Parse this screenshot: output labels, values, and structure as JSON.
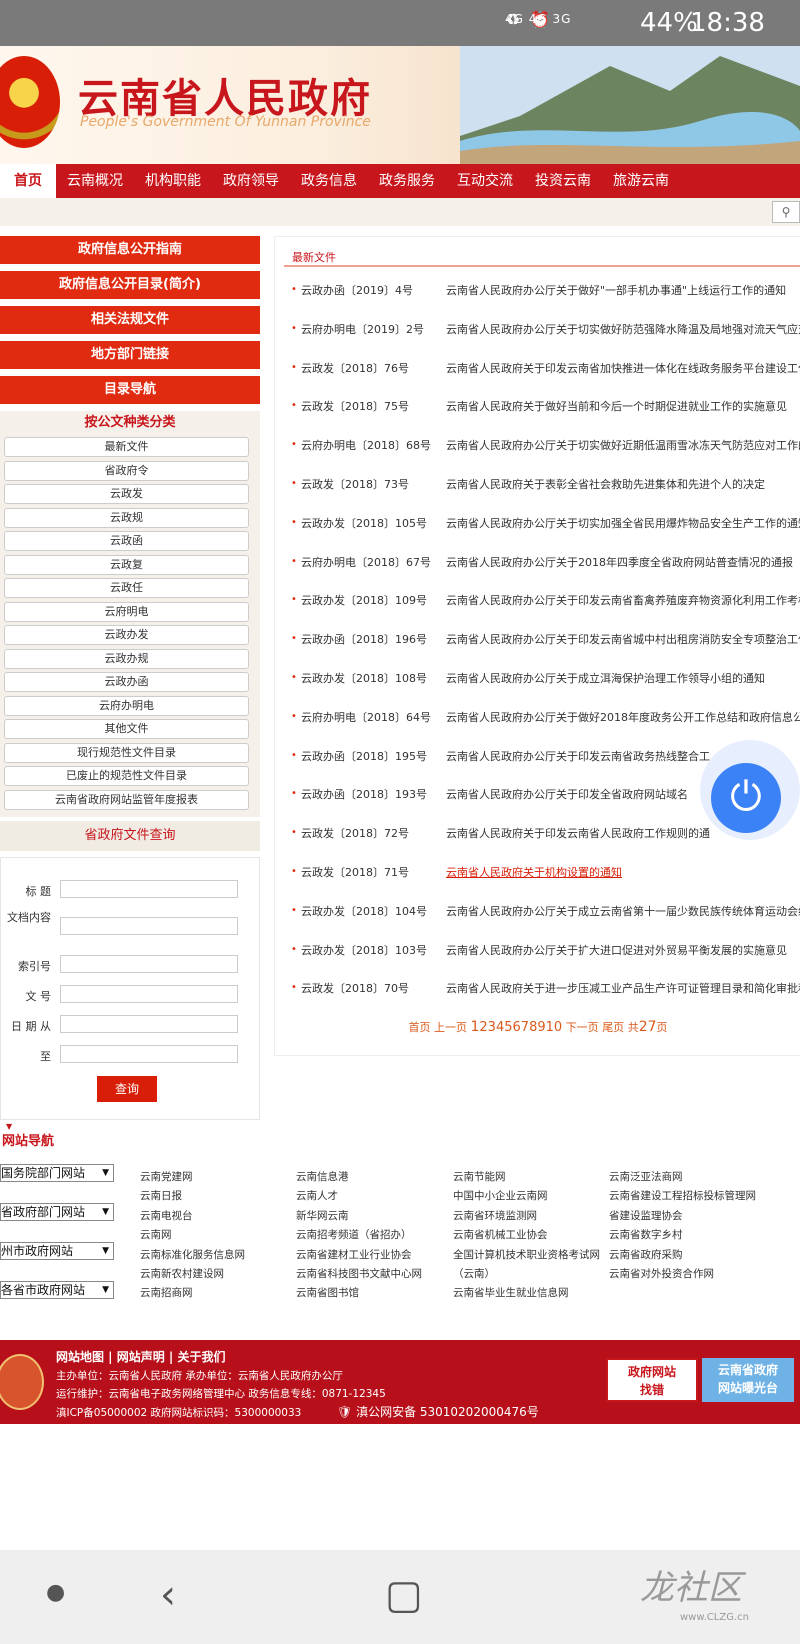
{
  "status_bar": {
    "signal_text": "4G 4G 3G",
    "battery": "44%",
    "time": "18:38"
  },
  "header": {
    "title": "云南省人民政府",
    "subtitle": "People's Government Of Yunnan Province"
  },
  "nav": {
    "items": [
      "首页",
      "云南概况",
      "机构职能",
      "政府领导",
      "政务信息",
      "政务服务",
      "互动交流",
      "投资云南",
      "旅游云南"
    ]
  },
  "sidebar": {
    "red_buttons": [
      "政府信息公开指南",
      "政府信息公开目录(简介)",
      "相关法规文件",
      "地方部门链接",
      "目录导航"
    ],
    "category_title": "按公文种类分类",
    "categories": [
      "最新文件",
      "省政府令",
      "云政发",
      "云政规",
      "云政函",
      "云政复",
      "云政任",
      "云府明电",
      "云政办发",
      "云政办规",
      "云政办函",
      "云府办明电",
      "其他文件",
      "现行规范性文件目录",
      "已废止的规范性文件目录",
      "云南省政府网站监管年度报表"
    ],
    "query_title": "省政府文件查询",
    "query_fields": {
      "title": "标 题",
      "content": "文档内容",
      "index": "索引号",
      "doc_no": "文 号",
      "date_from": "日 期 从",
      "date_to": "至"
    },
    "query_button": "查询"
  },
  "main": {
    "tab_label": "最新文件",
    "rows": [
      {
        "code": "云政办函〔2019〕4号",
        "title": "云南省人民政府办公厅关于做好\"一部手机办事通\"上线运行工作的通知"
      },
      {
        "code": "云府办明电〔2019〕2号",
        "title": "云南省人民政府办公厅关于切实做好防范强降水降温及局地强对流天气应对"
      },
      {
        "code": "云政发〔2018〕76号",
        "title": "云南省人民政府关于印发云南省加快推进一体化在线政务服务平台建设工作"
      },
      {
        "code": "云政发〔2018〕75号",
        "title": "云南省人民政府关于做好当前和今后一个时期促进就业工作的实施意见"
      },
      {
        "code": "云府办明电〔2018〕68号",
        "title": "云南省人民政府办公厅关于切实做好近期低温雨雪冰冻天气防范应对工作的"
      },
      {
        "code": "云政发〔2018〕73号",
        "title": "云南省人民政府关于表彰全省社会救助先进集体和先进个人的决定"
      },
      {
        "code": "云政办发〔2018〕105号",
        "title": "云南省人民政府办公厅关于切实加强全省民用爆炸物品安全生产工作的通知"
      },
      {
        "code": "云府办明电〔2018〕67号",
        "title": "云南省人民政府办公厅关于2018年四季度全省政府网站普查情况的通报"
      },
      {
        "code": "云政办发〔2018〕109号",
        "title": "云南省人民政府办公厅关于印发云南省畜禽养殖废弃物资源化利用工作考核"
      },
      {
        "code": "云政办函〔2018〕196号",
        "title": "云南省人民政府办公厅关于印发云南省城中村出租房消防安全专项整治工作"
      },
      {
        "code": "云政办发〔2018〕108号",
        "title": "云南省人民政府办公厅关于成立洱海保护治理工作领导小组的通知"
      },
      {
        "code": "云府办明电〔2018〕64号",
        "title": "云南省人民政府办公厅关于做好2018年度政务公开工作总结和政府信息公"
      },
      {
        "code": "云政办函〔2018〕195号",
        "title": "云南省人民政府办公厅关于印发云南省政务热线整合工"
      },
      {
        "code": "云政办函〔2018〕193号",
        "title": "云南省人民政府办公厅关于印发全省政府网站域名"
      },
      {
        "code": "云政发〔2018〕72号",
        "title": "云南省人民政府关于印发云南省人民政府工作规则的通"
      },
      {
        "code": "云政发〔2018〕71号",
        "title": "云南省人民政府关于机构设置的通知",
        "link": true
      },
      {
        "code": "云政办发〔2018〕104号",
        "title": "云南省人民政府办公厅关于成立云南省第十一届少数民族传统体育运动会组"
      },
      {
        "code": "云政办发〔2018〕103号",
        "title": "云南省人民政府办公厅关于扩大进口促进对外贸易平衡发展的实施意见"
      },
      {
        "code": "云政发〔2018〕70号",
        "title": "云南省人民政府关于进一步压减工业产品生产许可证管理目录和简化审批程"
      }
    ],
    "pager": {
      "first": "首页",
      "prev": "上一页",
      "pages": [
        "1",
        "2",
        "3",
        "4",
        "5",
        "6",
        "7",
        "8",
        "9",
        "10"
      ],
      "next": "下一页",
      "last": "尾页",
      "total_prefix": "共",
      "total": "27",
      "total_suffix": "页"
    }
  },
  "site_nav": {
    "title": "网站导航",
    "selects": [
      "国务院部门网站",
      "省政府部门网站",
      "州市政府网站",
      "各省市政府网站"
    ],
    "col1": [
      "云南党建网",
      "云南日报",
      "云南电视台",
      "云南网",
      "云南标准化服务信息网",
      "云南新农村建设网",
      "云南招商网"
    ],
    "col2": [
      "云南信息港",
      "云南人才",
      "新华网云南",
      "云南招考频道（省招办）",
      "云南省建材工业行业协会",
      "云南省科技图书文献中心网",
      "云南省图书馆"
    ],
    "col3": [
      "云南节能网",
      "中国中小企业云南网",
      "云南省环境监测网",
      "云南省机械工业协会",
      "全国计算机技术职业资格考试网",
      "（云南）",
      "云南省毕业生就业信息网"
    ],
    "col4": [
      "云南泛亚法商网",
      "云南省建设工程招标投标管理网",
      "省建设监理协会",
      "云南省数字乡村",
      "云南省政府采购",
      "云南省对外投资合作网"
    ]
  },
  "footer": {
    "links": "网站地图 | 网站声明 | 关于我们",
    "sponsor": "主办单位：云南省人民政府   承办单位：云南省人民政府办公厅",
    "maintainer": "运行维护：云南省电子政务网络管理中心   政务信息专线：0871-12345",
    "icp": "滇ICP备05000002   政府网站标识码：5300000033",
    "police": "滇公网安备 53010202000476号",
    "btn1": "政府网站\n找错",
    "btn2": "云南省政府\n网站曝光台"
  },
  "watermark": {
    "text": "龙社区",
    "url": "www.CLZG.cn"
  }
}
